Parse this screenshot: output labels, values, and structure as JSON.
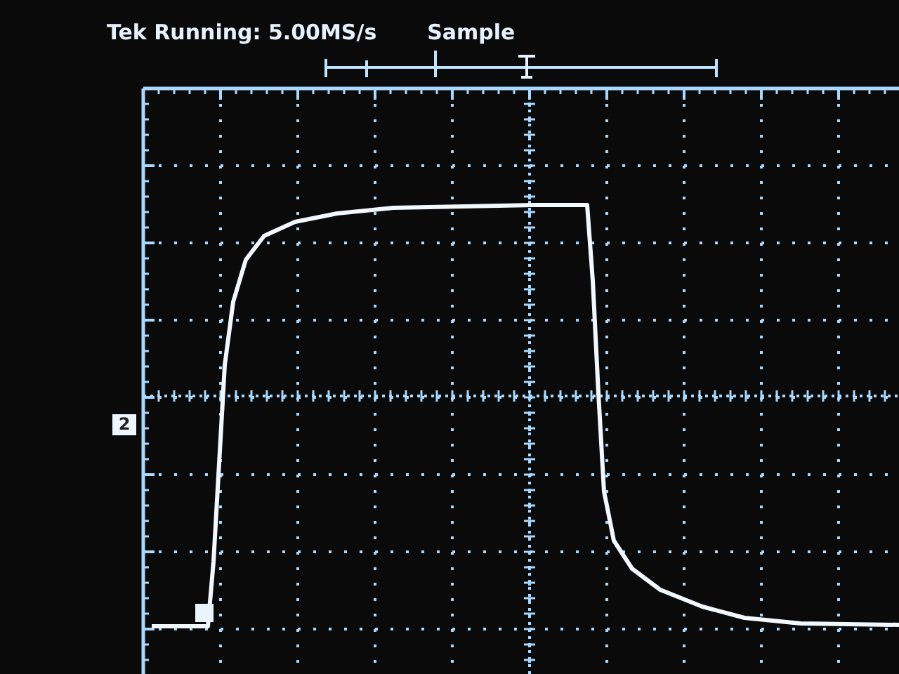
{
  "status_bar": {
    "acquisition": "Tek Running: 5.00MS/s",
    "mode": "Sample"
  },
  "channel_marker": {
    "label": "2"
  }
}
